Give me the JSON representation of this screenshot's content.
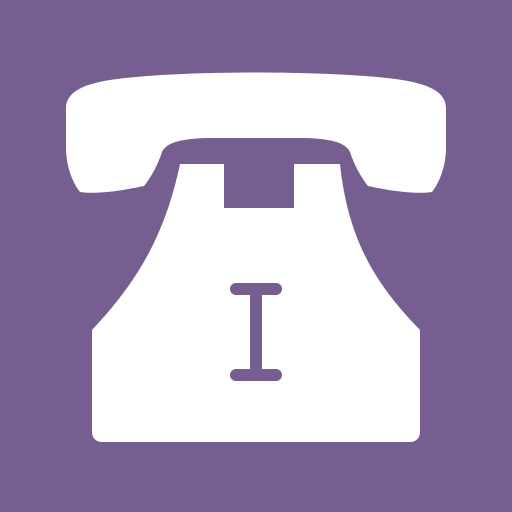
{
  "icon": {
    "name": "rotary-telephone-icon",
    "colors": {
      "background": "#775E91",
      "foreground": "#FFFFFF"
    }
  }
}
